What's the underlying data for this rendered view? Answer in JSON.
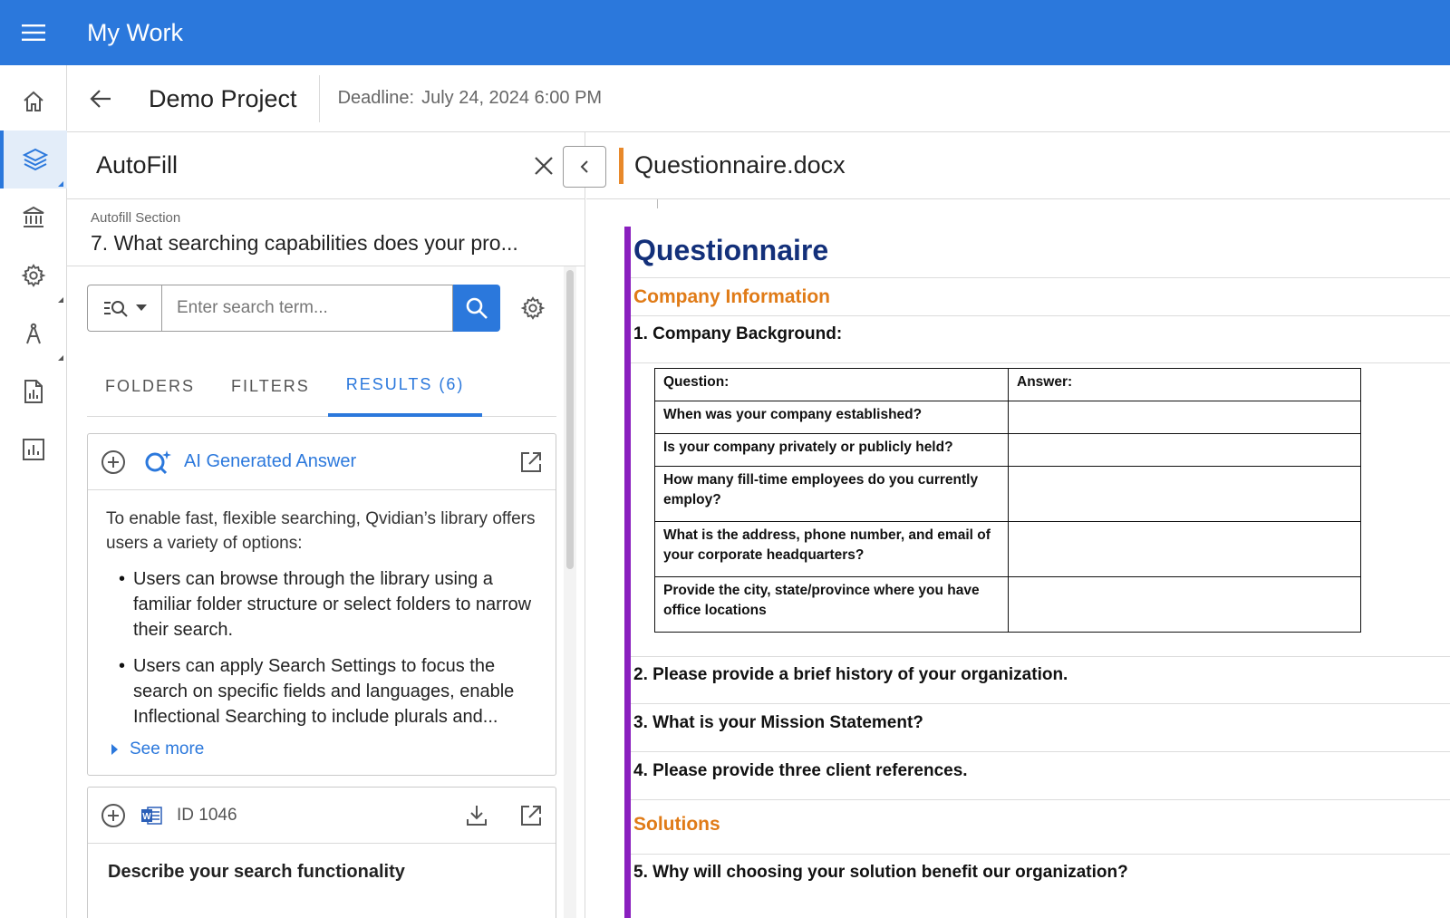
{
  "topbar": {
    "title": "My Work"
  },
  "header": {
    "project_title": "Demo Project",
    "deadline_label": "Deadline:",
    "deadline_value": "July 24, 2024 6:00 PM"
  },
  "autofill": {
    "title": "AutoFill",
    "section_label": "Autofill Section",
    "section_value": "7. What searching capabilities does your pro...",
    "search": {
      "placeholder": "Enter search term..."
    },
    "tabs": [
      {
        "label": "FOLDERS"
      },
      {
        "label": "FILTERS"
      },
      {
        "label": "RESULTS (6)"
      }
    ],
    "ai_card": {
      "title": "AI Generated Answer",
      "intro": "To enable fast, flexible searching, Qvidian’s library offers users a variety of options:",
      "bullets": [
        "Users can browse through the library using a familiar folder structure or select folders to narrow their search.",
        "Users can apply Search Settings to focus the search on specific fields and languages, enable Inflectional Searching to include plurals and..."
      ],
      "see_more": "See more"
    },
    "result_card": {
      "id_label": "ID 1046",
      "title": "Describe your search functionality"
    }
  },
  "document": {
    "file_name": "Questionnaire.docx",
    "title": "Questionnaire",
    "section1": "Company Information",
    "q1": "1.  Company Background:",
    "table": {
      "headers": [
        "Question:",
        "Answer:"
      ],
      "rows": [
        "When was your company established?",
        "Is your company privately or publicly held?",
        "How many fill-time employees do you currently employ?",
        "What is the address, phone number, and email of your corporate headquarters?",
        "Provide the city, state/province where you have office locations"
      ]
    },
    "q2": "2.  Please provide a brief history of your organization.",
    "q3": "3.  What is your Mission Statement?",
    "q4": "4.  Please provide three client references.",
    "section2": "Solutions",
    "q5": "5.  Why will choosing your solution benefit our organization?"
  },
  "colors": {
    "brand_blue": "#2b78dc",
    "doc_purple": "#8a1fbf",
    "heading_orange": "#e07b17",
    "title_navy": "#13307a"
  }
}
